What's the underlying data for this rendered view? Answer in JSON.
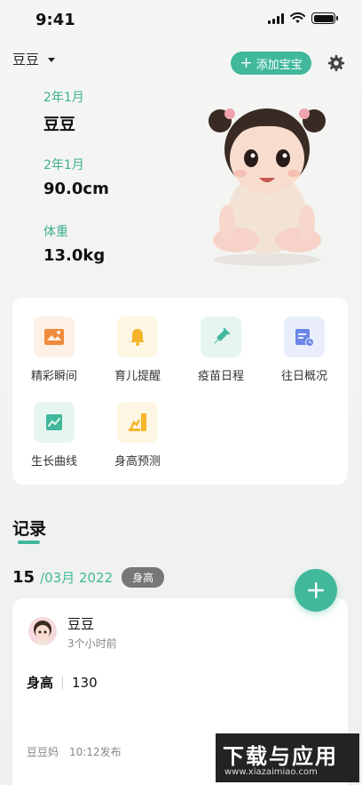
{
  "status_bar": {
    "time": "9:41"
  },
  "header": {
    "baby_name": "豆豆",
    "add_baby_label": "添加宝宝",
    "add_baby_plus": "+"
  },
  "profile": {
    "name_label": "2年1月",
    "name_value": "豆豆",
    "height_label": "2年1月",
    "height_value": "90.0cm",
    "weight_label": "体重",
    "weight_value": "13.0kg"
  },
  "menu": {
    "items": [
      {
        "label": "精彩瞬间",
        "icon": "photo-icon",
        "color": "#f08a3c",
        "bg": "#fdf0e6"
      },
      {
        "label": "育儿提醒",
        "icon": "bell-icon",
        "color": "#f5b52a",
        "bg": "#fdf6e3"
      },
      {
        "label": "疫苗日程",
        "icon": "syringe-icon",
        "color": "#41b89c",
        "bg": "#e6f5f0"
      },
      {
        "label": "往日概况",
        "icon": "calendar-clock-icon",
        "color": "#6b86e8",
        "bg": "#eaeefc"
      },
      {
        "label": "生长曲线",
        "icon": "chart-icon",
        "color": "#41b89c",
        "bg": "#e6f5f0"
      },
      {
        "label": "身高预测",
        "icon": "ruler-icon",
        "color": "#f5b52a",
        "bg": "#fdf6e3"
      }
    ]
  },
  "records": {
    "title": "记录",
    "date_day": "15",
    "date_rest": "/03月 2022",
    "tag": "身高",
    "fab_label": "+",
    "card": {
      "name": "豆豆",
      "time_ago": "3个小时前",
      "metric_label": "身高",
      "metric_value": "130",
      "author": "豆豆妈",
      "posted": "10:12发布"
    }
  },
  "watermark": {
    "title": "下载与应用",
    "url": "www.xiazaimiao.com"
  },
  "colors": {
    "accent": "#41b89c"
  }
}
